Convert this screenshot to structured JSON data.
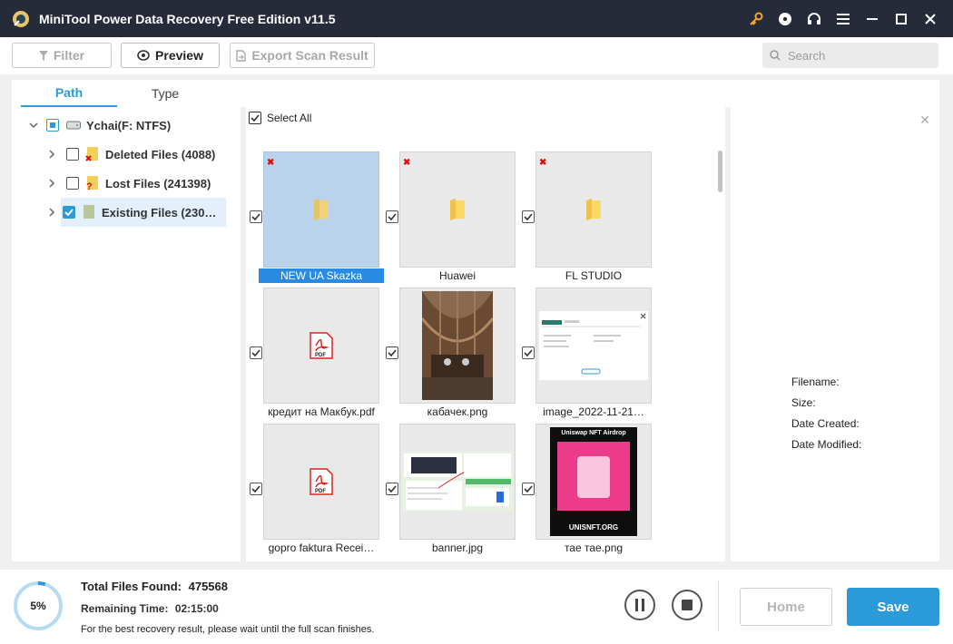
{
  "window": {
    "title": "MiniTool Power Data Recovery Free Edition v11.5",
    "icons": [
      "key-icon",
      "disc-icon",
      "headphones-icon",
      "menu-icon",
      "minimize-icon",
      "maximize-icon",
      "close-icon"
    ]
  },
  "toolbar": {
    "filter_label": "Filter",
    "preview_label": "Preview",
    "export_label": "Export Scan Result",
    "search_placeholder": "Search"
  },
  "tabs": [
    {
      "label": "Path",
      "active": true
    },
    {
      "label": "Type",
      "active": false
    }
  ],
  "tree": {
    "root": "Ychai(F: NTFS)",
    "items": [
      {
        "label": "Deleted Files (4088)",
        "checked": false
      },
      {
        "label": "Lost Files (241398)",
        "checked": false
      },
      {
        "label": "Existing Files (230…",
        "checked": true
      }
    ]
  },
  "grid": {
    "select_all_label": "Select All",
    "items": [
      {
        "name": "NEW UA Skazka",
        "kind": "folder",
        "deleted": true,
        "selected": true
      },
      {
        "name": "Huawei",
        "kind": "folder",
        "deleted": true
      },
      {
        "name": "FL STUDIO",
        "kind": "folder",
        "deleted": true
      },
      {
        "name": "кредит на Макбук.pdf",
        "kind": "pdf"
      },
      {
        "name": "кабачек.png",
        "kind": "photo"
      },
      {
        "name": "image_2022-11-21…",
        "kind": "screenshot"
      },
      {
        "name": "gopro faktura Recei…",
        "kind": "pdf"
      },
      {
        "name": "banner.jpg",
        "kind": "banner"
      },
      {
        "name": "тае тае.png",
        "kind": "nft"
      }
    ],
    "nft_thumb": {
      "title": "Uniswap NFT Airdrop",
      "footer": "UNISNFT.ORG"
    }
  },
  "preview": {
    "filename_label": "Filename:",
    "size_label": "Size:",
    "created_label": "Date Created:",
    "modified_label": "Date Modified:"
  },
  "status": {
    "progress_text": "5%",
    "progress_fraction": 0.05,
    "total_label": "Total Files Found:",
    "total_value": "475568",
    "remaining_label": "Remaining Time:",
    "remaining_value": "02:15:00",
    "note": "For the best recovery result, please wait until the full scan finishes.",
    "home_label": "Home",
    "save_label": "Save"
  },
  "colors": {
    "accent": "#2a9ad8",
    "titlebar": "#262b3a",
    "selection": "#2a8be3"
  }
}
